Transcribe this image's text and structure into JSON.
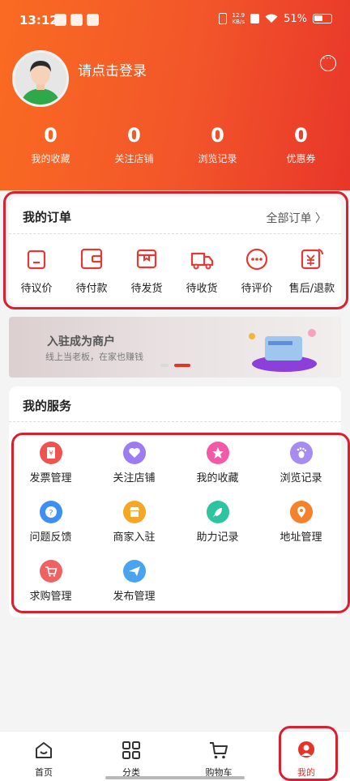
{
  "status_bar": {
    "time": "13:12",
    "speed_value": "12.9",
    "speed_unit": "KB/s",
    "battery": "51%"
  },
  "profile": {
    "login_prompt": "请点击登录"
  },
  "stats": [
    {
      "value": "0",
      "label": "我的收藏"
    },
    {
      "value": "0",
      "label": "关注店铺"
    },
    {
      "value": "0",
      "label": "浏览记录"
    },
    {
      "value": "0",
      "label": "优惠券"
    }
  ],
  "orders": {
    "title": "我的订单",
    "all_label": "全部订单 〉",
    "items": [
      {
        "label": "待议价",
        "icon": "pending-negotiation-icon"
      },
      {
        "label": "待付款",
        "icon": "wallet-icon"
      },
      {
        "label": "待发货",
        "icon": "package-icon"
      },
      {
        "label": "待收货",
        "icon": "truck-icon"
      },
      {
        "label": "待评价",
        "icon": "comment-icon"
      },
      {
        "label": "售后/退款",
        "icon": "refund-icon"
      }
    ]
  },
  "banner": {
    "title": "入驻成为商户",
    "subtitle": "线上当老板，在家也赚钱"
  },
  "services": {
    "title": "我的服务",
    "items": [
      {
        "label": "发票管理",
        "icon": "invoice-icon",
        "color": "#ef5350"
      },
      {
        "label": "关注店铺",
        "icon": "heart-icon",
        "color": "#9c7cf3"
      },
      {
        "label": "我的收藏",
        "icon": "star-icon",
        "color": "#f25aa8"
      },
      {
        "label": "浏览记录",
        "icon": "footprint-icon",
        "color": "#a78bf0"
      },
      {
        "label": "问题反馈",
        "icon": "question-icon",
        "color": "#3d8ef5"
      },
      {
        "label": "商家入驻",
        "icon": "shop-icon",
        "color": "#f5a623"
      },
      {
        "label": "助力记录",
        "icon": "rocket-icon",
        "color": "#2ec4a0"
      },
      {
        "label": "地址管理",
        "icon": "location-icon",
        "color": "#f5822a"
      },
      {
        "label": "求购管理",
        "icon": "cart-icon",
        "color": "#f06262"
      },
      {
        "label": "发布管理",
        "icon": "send-icon",
        "color": "#4aa3f0"
      }
    ]
  },
  "tabbar": [
    {
      "label": "首页",
      "icon": "home-icon"
    },
    {
      "label": "分类",
      "icon": "category-icon"
    },
    {
      "label": "购物车",
      "icon": "cart-icon"
    },
    {
      "label": "我的",
      "icon": "profile-icon"
    }
  ],
  "colors": {
    "header_start": "#fa6b22",
    "header_end": "#e8362a",
    "accent": "#e63328",
    "outline": "#d8202f"
  }
}
